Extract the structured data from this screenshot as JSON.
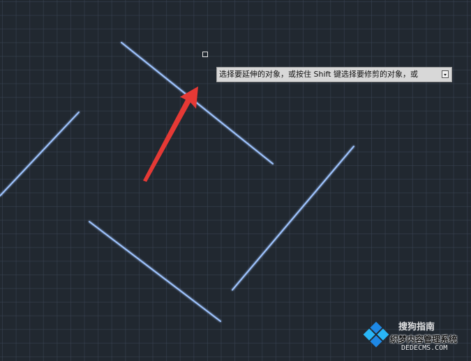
{
  "canvas": {
    "background_color": "#212830",
    "grid_color": "#3a4454",
    "line_color": "#9fc4ff"
  },
  "command_tooltip": {
    "text": "选择要延伸的对象，或按住 Shift 键选择要修剪的对象，或",
    "options_icon": "dropdown-arrow-icon"
  },
  "annotation": {
    "arrow_color": "#e53935"
  },
  "watermark": {
    "brand": "搜狗指南",
    "subtitle": "织梦内容管理系统",
    "url": "DEDECMS.COM"
  }
}
